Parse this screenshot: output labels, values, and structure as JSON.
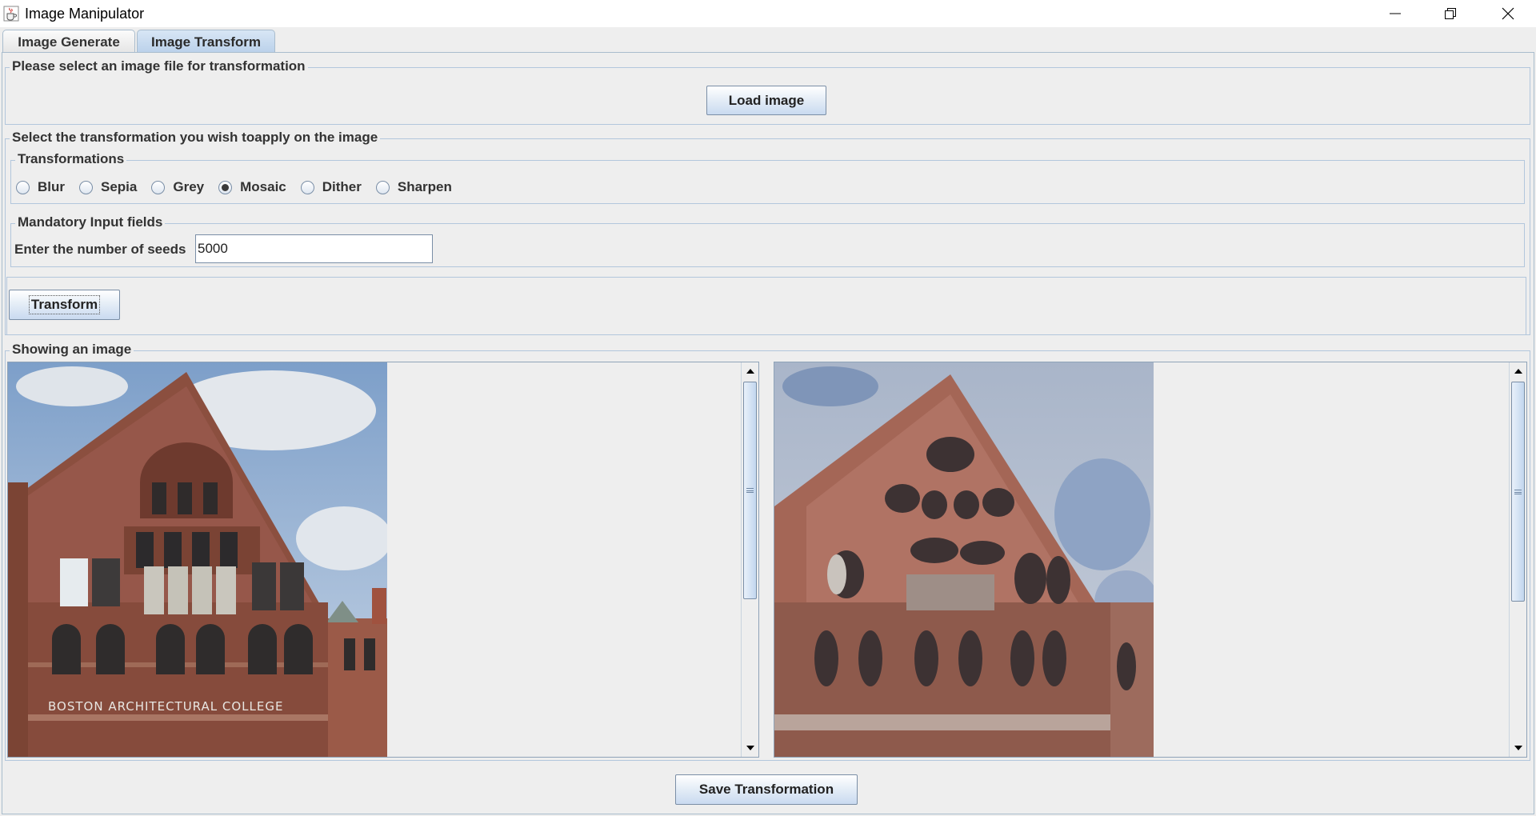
{
  "window": {
    "title": "Image Manipulator",
    "icon": "java-cup-icon",
    "controls": [
      "minimize-icon",
      "restore-icon",
      "close-icon"
    ]
  },
  "tabs": [
    {
      "label": "Image Generate",
      "selected": false
    },
    {
      "label": "Image Transform",
      "selected": true
    }
  ],
  "load_section": {
    "title": "Please select an image file for transformation",
    "button_label": "Load image"
  },
  "transform_section": {
    "title": "Select the transformation you wish toapply on the image",
    "options_title": "Transformations",
    "options": [
      {
        "label": "Blur",
        "selected": false
      },
      {
        "label": "Sepia",
        "selected": false
      },
      {
        "label": "Grey",
        "selected": false
      },
      {
        "label": "Mosaic",
        "selected": true
      },
      {
        "label": "Dither",
        "selected": false
      },
      {
        "label": "Sharpen",
        "selected": false
      }
    ],
    "inputs_title": "Mandatory Input fields",
    "seeds_label": "Enter the number of seeds",
    "seeds_value": "5000",
    "transform_button": "Transform"
  },
  "display_section": {
    "title": "Showing an image",
    "original_image_caption": "BOSTON ARCHITECTURAL COLLEGE"
  },
  "save_button": "Save Transformation",
  "colors": {
    "window_bg": "#eeeeee",
    "border": "#b2c6dc",
    "selected_tab": "#b9d0ea",
    "button_gradient_end": "#c9daf0"
  }
}
